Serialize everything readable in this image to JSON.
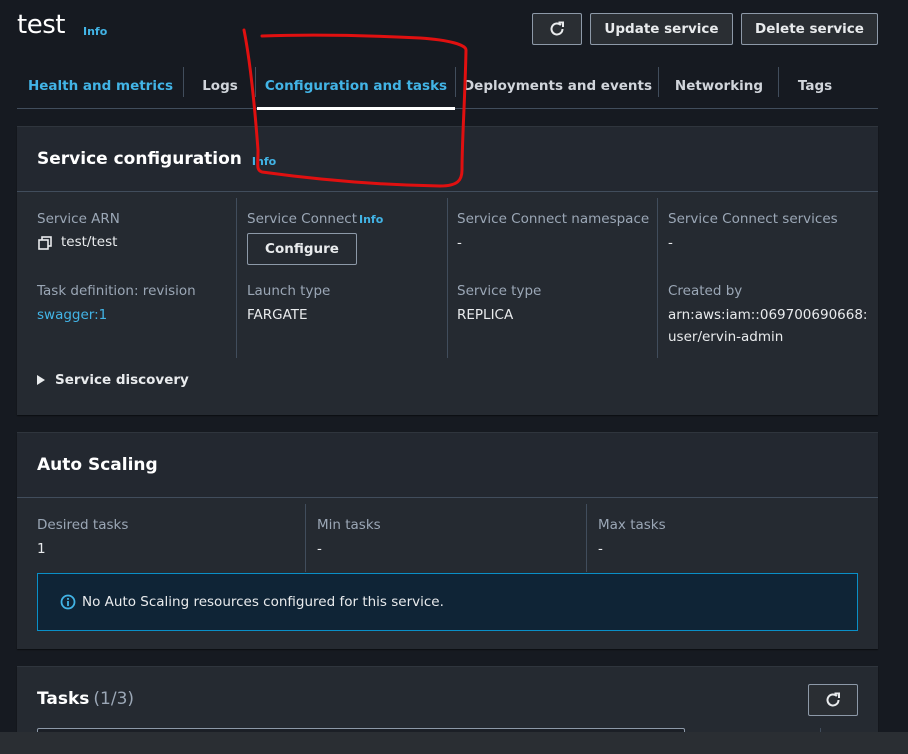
{
  "header": {
    "title": "test",
    "info_label": "Info",
    "buttons": {
      "refresh_icon": "refresh-icon",
      "update": "Update service",
      "delete": "Delete service"
    }
  },
  "tabs": [
    {
      "label": "Health and metrics",
      "state": "link"
    },
    {
      "label": "Logs",
      "state": "default"
    },
    {
      "label": "Configuration and tasks",
      "state": "selected"
    },
    {
      "label": "Deployments and events",
      "state": "default"
    },
    {
      "label": "Networking",
      "state": "default"
    },
    {
      "label": "Tags",
      "state": "default"
    }
  ],
  "service_configuration": {
    "title": "Service configuration",
    "info_label": "Info",
    "fields": {
      "service_arn": {
        "label": "Service ARN",
        "value": "test/test",
        "icon": "copy-icon"
      },
      "service_connect": {
        "label": "Service Connect",
        "info_label": "Info",
        "button": "Configure"
      },
      "service_connect_namespace": {
        "label": "Service Connect namespace",
        "value": "-"
      },
      "service_connect_services": {
        "label": "Service Connect services",
        "value": "-"
      },
      "task_definition": {
        "label": "Task definition: revision",
        "value": "swagger:1"
      },
      "launch_type": {
        "label": "Launch type",
        "value": "FARGATE"
      },
      "service_type": {
        "label": "Service type",
        "value": "REPLICA"
      },
      "created_by": {
        "label": "Created by",
        "value_line1": "arn:aws:iam::069700690668:",
        "value_line2": "user/ervin-admin"
      }
    },
    "expander": "Service discovery"
  },
  "auto_scaling": {
    "title": "Auto Scaling",
    "fields": {
      "desired": {
        "label": "Desired tasks",
        "value": "1"
      },
      "min": {
        "label": "Min tasks",
        "value": "-"
      },
      "max": {
        "label": "Max tasks",
        "value": "-"
      }
    },
    "alert": {
      "icon": "info-circle-icon",
      "text": "No Auto Scaling resources configured for this service."
    }
  },
  "tasks": {
    "title": "Tasks",
    "counter": "(1/3)",
    "refresh_icon": "refresh-icon"
  },
  "colors": {
    "accent_link": "#42b4e6",
    "background": "#161a21",
    "panel": "#252a31",
    "alert_border": "#0a8fc7",
    "alert_bg": "#0f2436",
    "annotation": "#e01010"
  }
}
